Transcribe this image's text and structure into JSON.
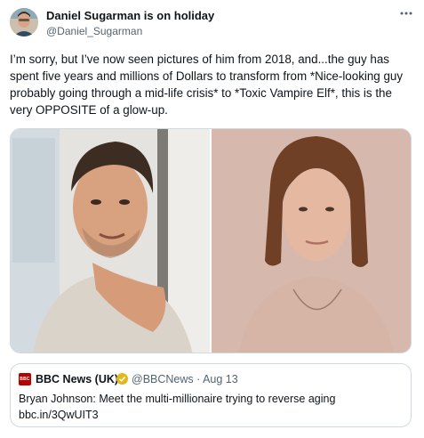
{
  "author": {
    "name": "Daniel Sugarman is on holiday",
    "handle": "@Daniel_Sugarman"
  },
  "tweet": {
    "text": "I’m sorry, but I’ve now seen pictures of him from 2018, and...the guy has spent five years and millions of Dollars to transform from *Nice-looking guy probably going through a mid-life crisis* to *Toxic Vampire Elf*, this is the very OPPOSITE of a glow-up."
  },
  "more_label": "···",
  "quoted": {
    "logo_text": "BBC",
    "name": "BBC News (UK)",
    "handle_date": "@BBCNews · Aug 13",
    "text": "Bryan Johnson: Meet the multi-millionaire trying to reverse aging",
    "link": "bbc.in/3QwUIT3"
  },
  "icons": {
    "more": "more-horizontal-icon",
    "verified": "verified-badge-icon"
  },
  "colors": {
    "text_primary": "#0f1419",
    "text_secondary": "#536471",
    "border": "#cfd9de",
    "bbc_red": "#b80000",
    "verified_gold": "#e2b719"
  }
}
